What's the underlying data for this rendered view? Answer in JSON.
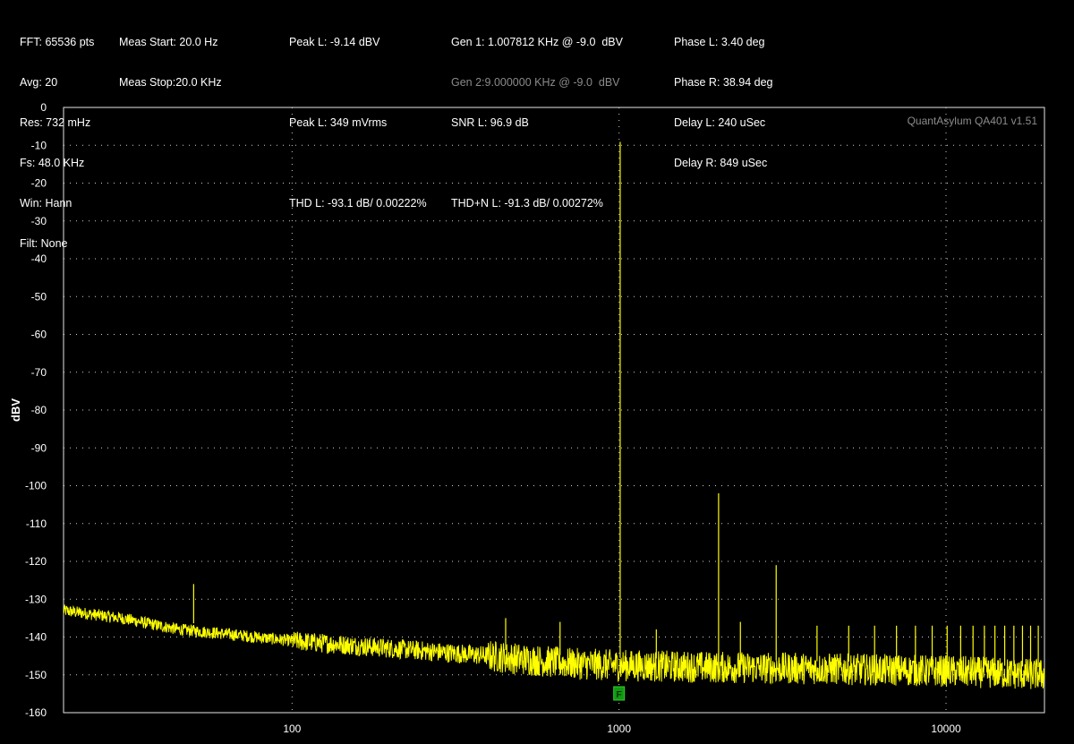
{
  "readouts": {
    "col1": [
      "FFT: 65536 pts",
      "Avg: 20",
      "Res: 732 mHz",
      "Fs: 48.0 KHz",
      "Win: Hann",
      "Filt: None"
    ],
    "col2": [
      "Meas Start: 20.0 Hz",
      "Meas Stop:20.0 KHz"
    ],
    "col3": [
      "Peak L: -9.14 dBV",
      "",
      "Peak L: 349 mVrms",
      "",
      "THD L: -93.1 dB/ 0.00222%"
    ],
    "col4": [
      "Gen 1: 1.007812 KHz @ -9.0  dBV",
      "Gen 2:9.000000 KHz @ -9.0  dBV",
      "SNR L: 96.9 dB",
      "",
      "THD+N L: -91.3 dB/ 0.00272%"
    ],
    "col5": [
      "Phase L: 3.40 deg",
      "Phase R: 38.94 deg",
      "Delay L: 240 uSec",
      "Delay R: 849 uSec"
    ]
  },
  "brand_label": "QuantAsylum QA401 v1.51",
  "marker_label": "F",
  "colors": {
    "trace": "#ffff00",
    "grid": "#cfcfcf",
    "marker_bg": "#119911",
    "background": "#000000"
  },
  "chart_data": {
    "type": "line",
    "xscale": "log",
    "xlim": [
      20,
      20000
    ],
    "ylim": [
      -160,
      0
    ],
    "ylabel": "dBV",
    "xlabel": "",
    "yticks": [
      0,
      -10,
      -20,
      -30,
      -40,
      -50,
      -60,
      -70,
      -80,
      -90,
      -100,
      -110,
      -120,
      -130,
      -140,
      -150,
      -160
    ],
    "xticks": [
      100,
      1000,
      10000
    ],
    "grid": true,
    "noise_floor": [
      [
        20,
        -133
      ],
      [
        30,
        -135
      ],
      [
        45,
        -138
      ],
      [
        60,
        -139
      ],
      [
        100,
        -141
      ],
      [
        200,
        -143
      ],
      [
        400,
        -145
      ],
      [
        700,
        -147
      ],
      [
        1000,
        -147.5
      ],
      [
        2000,
        -148
      ],
      [
        5000,
        -148.5
      ],
      [
        10000,
        -149
      ],
      [
        20000,
        -150
      ]
    ],
    "peaks": [
      {
        "freq": 50,
        "level": -126
      },
      {
        "freq": 450,
        "level": -135
      },
      {
        "freq": 660,
        "level": -136
      },
      {
        "freq": 1007.8,
        "level": -9.1
      },
      {
        "freq": 1300,
        "level": -138
      },
      {
        "freq": 2015.6,
        "level": -102
      },
      {
        "freq": 2350,
        "level": -136
      },
      {
        "freq": 3023.4,
        "level": -121
      },
      {
        "freq": 4031.2,
        "level": -137
      },
      {
        "freq": 5039.1,
        "level": -137
      },
      {
        "freq": 6046.9,
        "level": -137
      },
      {
        "freq": 7054.7,
        "level": -137
      },
      {
        "freq": 8062.5,
        "level": -137
      },
      {
        "freq": 9070.3,
        "level": -137
      },
      {
        "freq": 10078,
        "level": -137
      },
      {
        "freq": 11086,
        "level": -137
      },
      {
        "freq": 12094,
        "level": -137
      },
      {
        "freq": 13102,
        "level": -137
      },
      {
        "freq": 14109,
        "level": -137
      },
      {
        "freq": 15117,
        "level": -137
      },
      {
        "freq": 16125,
        "level": -137
      },
      {
        "freq": 17133,
        "level": -137
      },
      {
        "freq": 18141,
        "level": -137
      },
      {
        "freq": 19148,
        "level": -137
      }
    ],
    "marker_freq": 1000
  }
}
